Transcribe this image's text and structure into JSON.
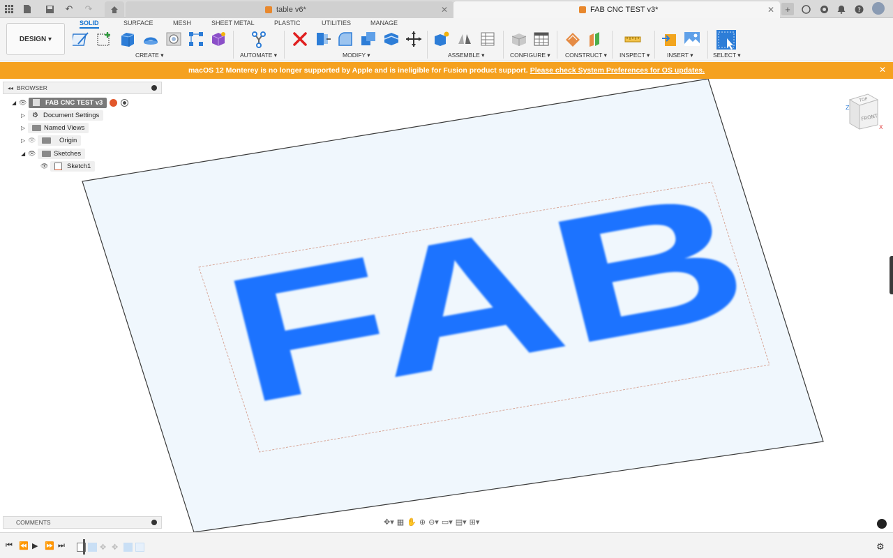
{
  "tabs": {
    "inactive_title": "table v6*",
    "active_title": "FAB CNC TEST v3*"
  },
  "toolbar": {
    "design_label": "DESIGN ▾",
    "workspaces": [
      "SOLID",
      "SURFACE",
      "MESH",
      "SHEET METAL",
      "PLASTIC",
      "UTILITIES",
      "MANAGE"
    ],
    "active_workspace": "SOLID",
    "groups": {
      "create": "CREATE ▾",
      "automate": "AUTOMATE ▾",
      "modify": "MODIFY ▾",
      "assemble": "ASSEMBLE ▾",
      "configure": "CONFIGURE ▾",
      "construct": "CONSTRUCT ▾",
      "inspect": "INSPECT ▾",
      "insert": "INSERT ▾",
      "select": "SELECT ▾"
    }
  },
  "banner": {
    "message": "macOS 12 Monterey is no longer supported by Apple and is ineligible for Fusion product support.",
    "link": "Please check System Preferences for OS updates."
  },
  "browser": {
    "title": "BROWSER",
    "root": "FAB CNC TEST v3",
    "items": [
      {
        "label": "Document Settings"
      },
      {
        "label": "Named Views"
      },
      {
        "label": "Origin"
      },
      {
        "label": "Sketches"
      },
      {
        "label": "Sketch1"
      }
    ]
  },
  "comments": {
    "title": "COMMENTS"
  },
  "viewport": {
    "sketch_text": "FAB",
    "text_color": "#1a73ff",
    "plane_color": "#f0f7fd"
  },
  "viewcube": {
    "top": "TOP",
    "front": "FRONT",
    "axis_z": "Z",
    "axis_x": "X"
  },
  "colors": {
    "accent": "#1473d1",
    "banner": "#f5a11f",
    "delete_red": "#e02020"
  }
}
